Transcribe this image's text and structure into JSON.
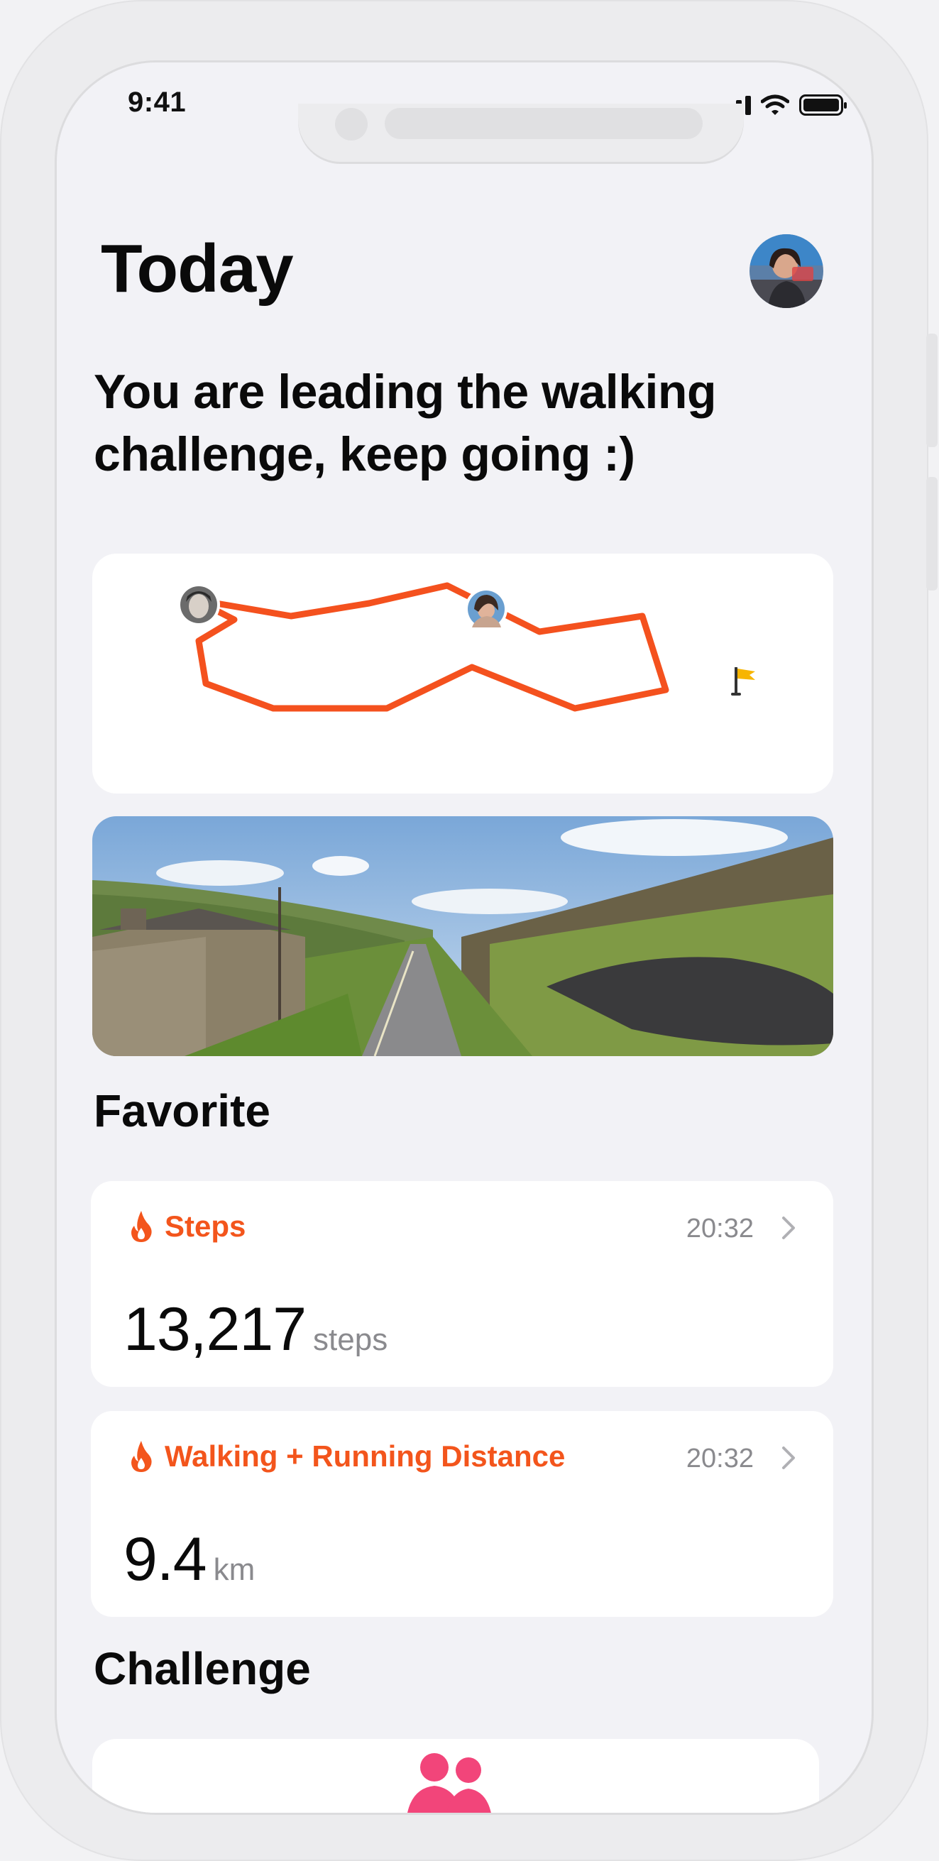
{
  "status_bar": {
    "time": "9:41"
  },
  "header": {
    "title": "Today"
  },
  "headline": "You are leading the walking challenge, keep going :)",
  "favorite": {
    "title": "Favorite",
    "metrics": [
      {
        "label": "Steps",
        "time": "20:32",
        "value": "13,217",
        "unit": "steps"
      },
      {
        "label": "Walking + Running Distance",
        "time": "20:32",
        "value": "9.4",
        "unit": "km"
      }
    ]
  },
  "challenge": {
    "title": "Challenge"
  },
  "colors": {
    "accent": "#f3551c",
    "route": "#f4511e",
    "challenge_icon": "#f2457a"
  },
  "icons": [
    "signal-icon",
    "wifi-icon",
    "battery-icon",
    "flame-icon",
    "chevron-right-icon",
    "flag-icon",
    "people-icon"
  ]
}
